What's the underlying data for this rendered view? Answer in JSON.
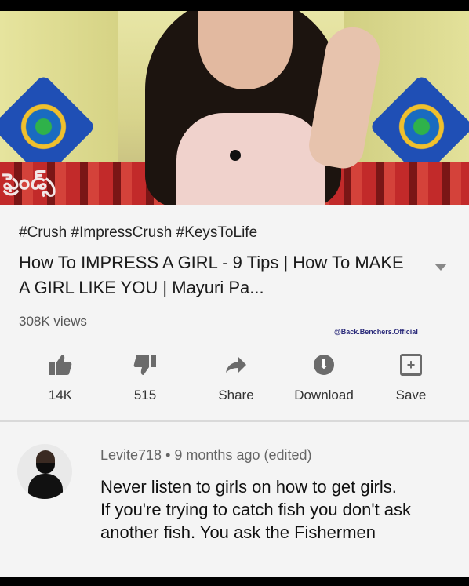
{
  "video": {
    "thumbnail_text": "ఫ్రెండ్స్",
    "hashtags": "#Crush #ImpressCrush #KeysToLife",
    "title": "How To IMPRESS A GIRL - 9 Tips | How To MAKE A GIRL LIKE YOU | Mayuri Pa...",
    "views": "308K views",
    "watermark": "@Back.Benchers.Official"
  },
  "actions": [
    {
      "label": "14K",
      "icon": "thumbs-up-icon"
    },
    {
      "label": "515",
      "icon": "thumbs-down-icon"
    },
    {
      "label": "Share",
      "icon": "share-icon"
    },
    {
      "label": "Download",
      "icon": "download-icon"
    },
    {
      "label": "Save",
      "icon": "add-to-playlist-icon"
    }
  ],
  "comment": {
    "author": "Levite718",
    "time": "9 months ago (edited)",
    "text": "Never listen to girls on how to get girls.\nIf you're trying to catch fish you don't ask another fish. You ask the Fishermen"
  }
}
